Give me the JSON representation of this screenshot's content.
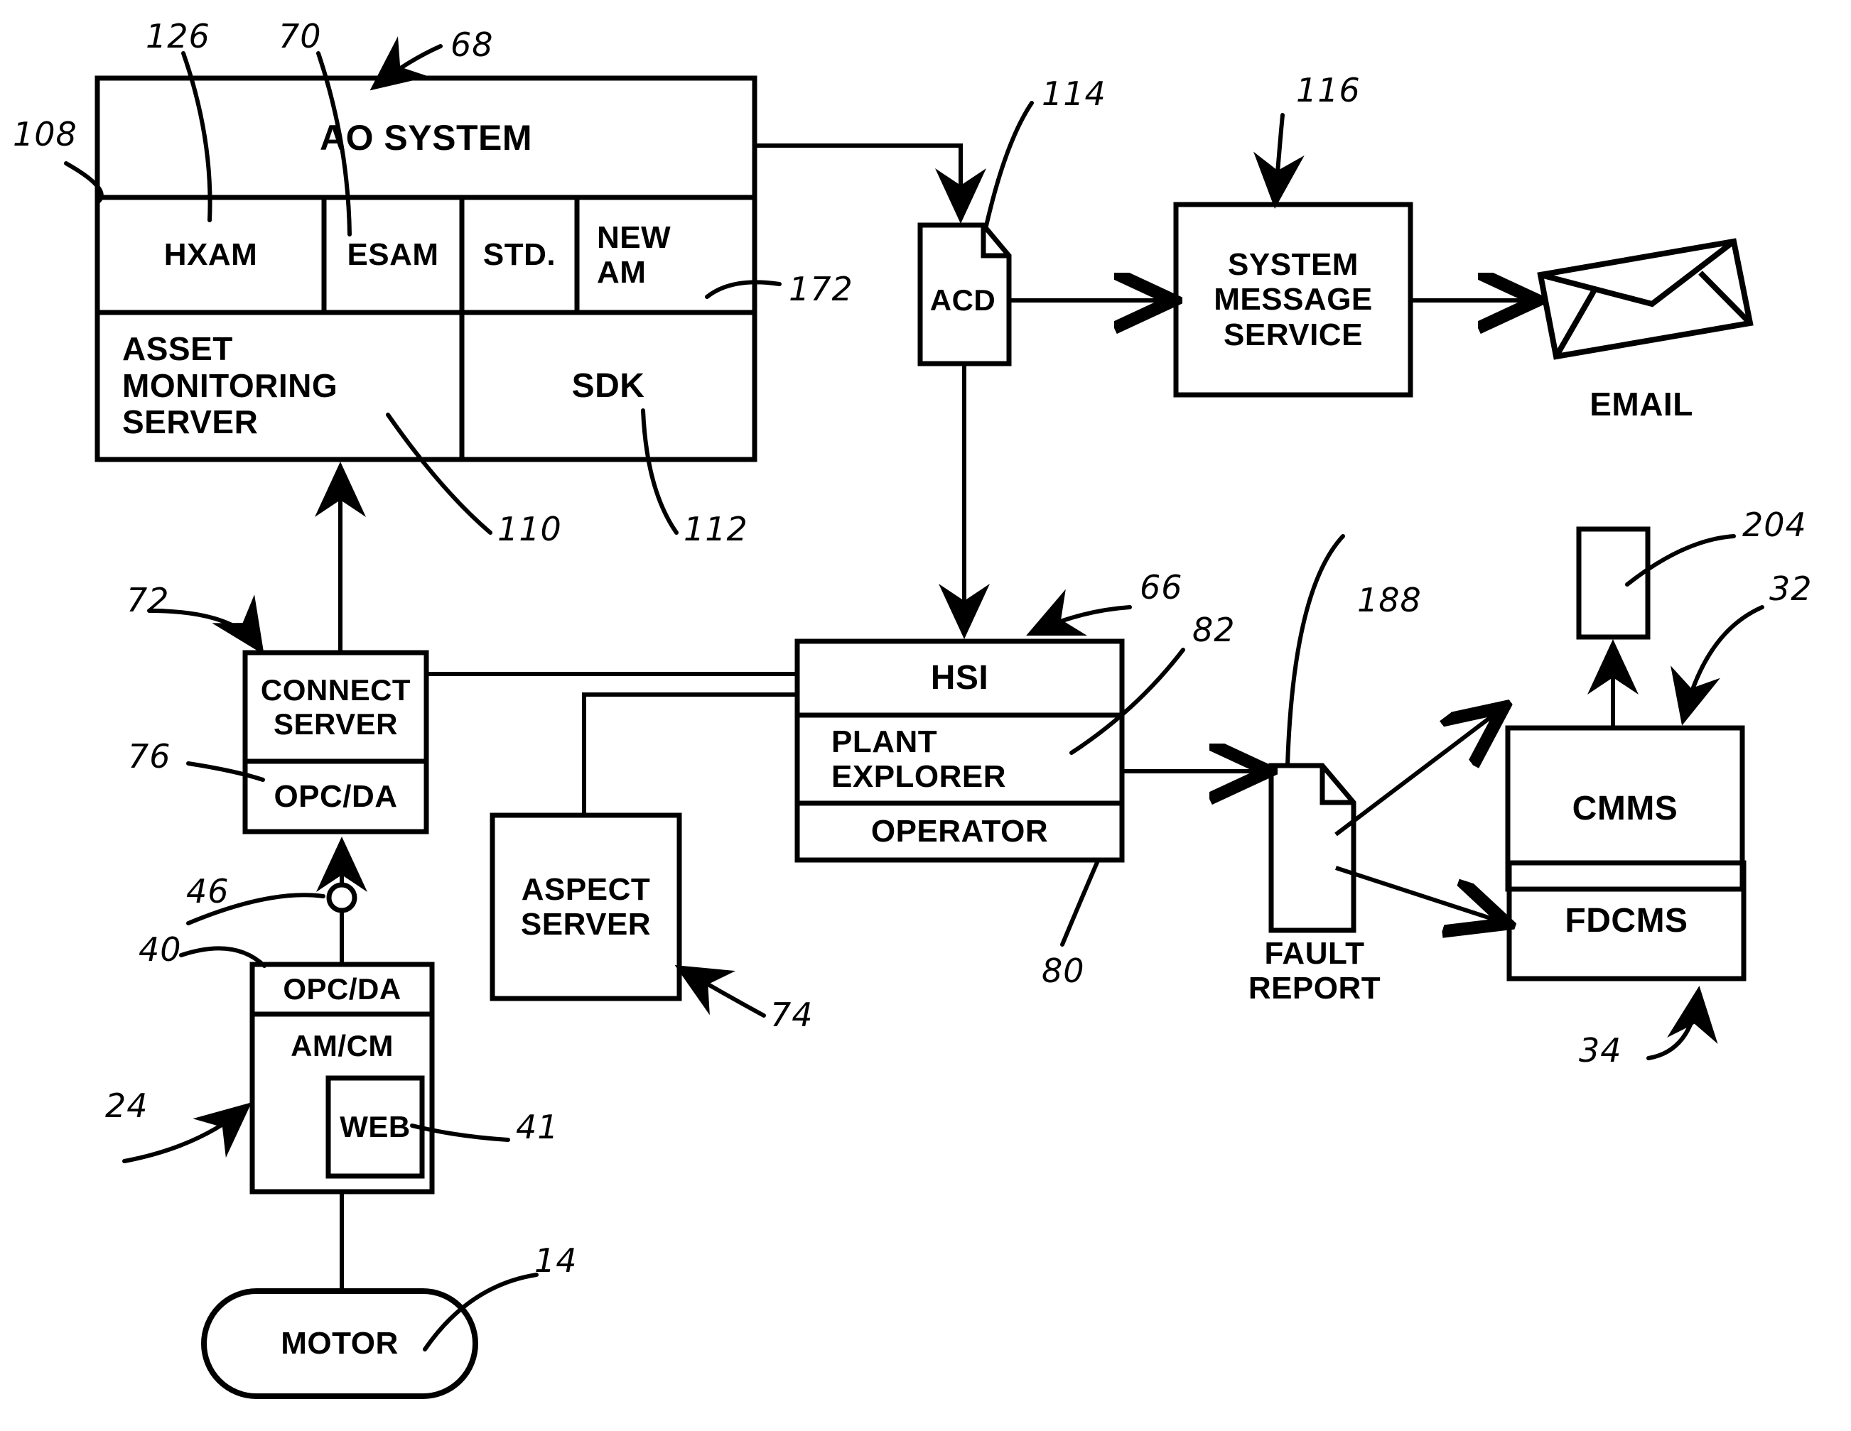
{
  "figure": {
    "type": "patent-block-diagram",
    "description": "Asset monitoring system block diagram"
  },
  "blocks": {
    "ao_system": "AO SYSTEM",
    "hxam": "HXAM",
    "esam": "ESAM",
    "std": "STD.",
    "new_am": "NEW\nAM",
    "asset_monitoring_server": "ASSET\nMONITORING\nSERVER",
    "sdk": "SDK",
    "acd": "ACD",
    "system_message_service": "SYSTEM\nMESSAGE\nSERVICE",
    "email": "EMAIL",
    "connect_server": "CONNECT\nSERVER",
    "connect_opcda": "OPC/DA",
    "aspect_server": "ASPECT\nSERVER",
    "hsi": "HSI",
    "plant_explorer": "PLANT\nEXPLORER",
    "operator": "OPERATOR",
    "fault_report": "FAULT\nREPORT",
    "cmms": "CMMS",
    "fdcms": "FDCMS",
    "device_opcda": "OPC/DA",
    "am_cm": "AM/CM",
    "web": "WEB",
    "motor": "MOTOR",
    "node_204": ""
  },
  "reference_numerals": {
    "n108": "108",
    "n126": "126",
    "n70": "70",
    "n68": "68",
    "n114": "114",
    "n116": "116",
    "n172": "172",
    "n110": "110",
    "n112": "112",
    "n72": "72",
    "n76": "76",
    "n46": "46",
    "n40": "40",
    "n24": "24",
    "n41": "41",
    "n14": "14",
    "n74": "74",
    "n66": "66",
    "n82": "82",
    "n80": "80",
    "n188": "188",
    "n204": "204",
    "n32": "32",
    "n34": "34"
  },
  "colors": {
    "line": "#000000",
    "background": "#ffffff"
  }
}
